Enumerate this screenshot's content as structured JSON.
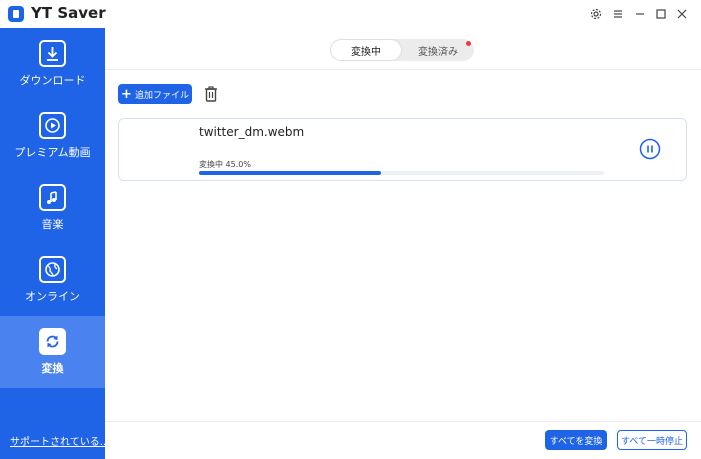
{
  "app": {
    "title": "YT Saver"
  },
  "window_controls": [
    "settings-icon",
    "menu-icon",
    "minimize-icon",
    "maximize-icon",
    "close-icon"
  ],
  "sidebar": {
    "items": [
      {
        "label": "ダウンロード",
        "icon": "download-icon",
        "active": false
      },
      {
        "label": "プレミアム動画",
        "icon": "play-circle-icon",
        "active": false
      },
      {
        "label": "音楽",
        "icon": "music-note-icon",
        "active": false
      },
      {
        "label": "オンライン",
        "icon": "globe-icon",
        "active": false
      },
      {
        "label": "変換",
        "icon": "convert-icon",
        "active": true
      }
    ],
    "support_link": "サポートされている..."
  },
  "tabs": [
    {
      "label": "変換中",
      "active": true
    },
    {
      "label": "変換済み",
      "active": false,
      "has_notification_dot": true
    }
  ],
  "toolbar": {
    "add_file_label": "追加ファイル"
  },
  "tasks": [
    {
      "file_name": "twitter_dm.webm",
      "status": "変換中 45.0%",
      "progress": 0.45
    }
  ],
  "footer": {
    "convert_all_label": "すべてを変換",
    "pause_all_label": "すべて一時停止"
  },
  "colors": {
    "accent": "#1f63e6",
    "sidebar_active": "#4a83ef",
    "notification": "#ef3b3b"
  }
}
